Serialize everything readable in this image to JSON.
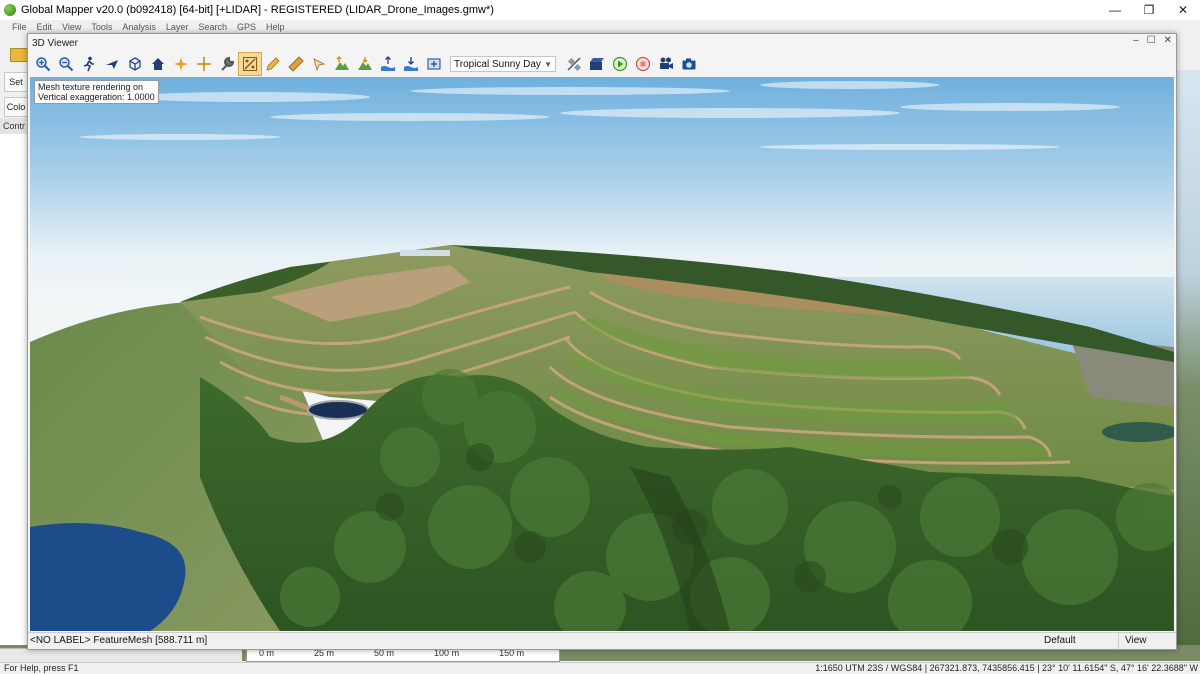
{
  "window": {
    "title": "Global Mapper v20.0 (b092418) [64-bit] [+LIDAR] - REGISTERED (LIDAR_Drone_Images.gmw*)",
    "minimize": "—",
    "maximize": "❐",
    "close": "✕"
  },
  "main_menu": [
    "File",
    "Edit",
    "View",
    "Tools",
    "Analysis",
    "Layer",
    "Search",
    "GPS",
    "Help"
  ],
  "background_toolbar": {
    "set_label": "Set",
    "color_label": "Colo"
  },
  "control_center": {
    "header": "Contr"
  },
  "viewer": {
    "title": "3D Viewer",
    "ctrl_minimize": "–",
    "ctrl_restore": "☐",
    "ctrl_close": "✕",
    "sky_preset": "Tropical Sunny Day",
    "info_line1": "Mesh texture rendering on",
    "info_line2": "Vertical exaggeration: 1.0000",
    "status_label": "<NO LABEL> FeatureMesh [588.711 m]",
    "status_default": "Default",
    "status_view": "View"
  },
  "scalebar": [
    "0 m",
    "25 m",
    "50 m",
    "100 m",
    "150 m"
  ],
  "statusbar": {
    "help": "For Help, press F1",
    "coords": "1:1650  UTM 23S / WGS84 | 267321.873, 7435856.415 | 23° 10' 11.6154\" S, 47° 16' 22.3688\" W"
  },
  "colors": {
    "sky_top": "#6fb0de",
    "sky_horizon": "#f3f6f7",
    "sea": "#8fc3df",
    "vegetation": "#3e6a2c",
    "terrace_grass": "#6e9d3e",
    "soil": "#b48c5f",
    "pond": "#1d4c8a"
  }
}
